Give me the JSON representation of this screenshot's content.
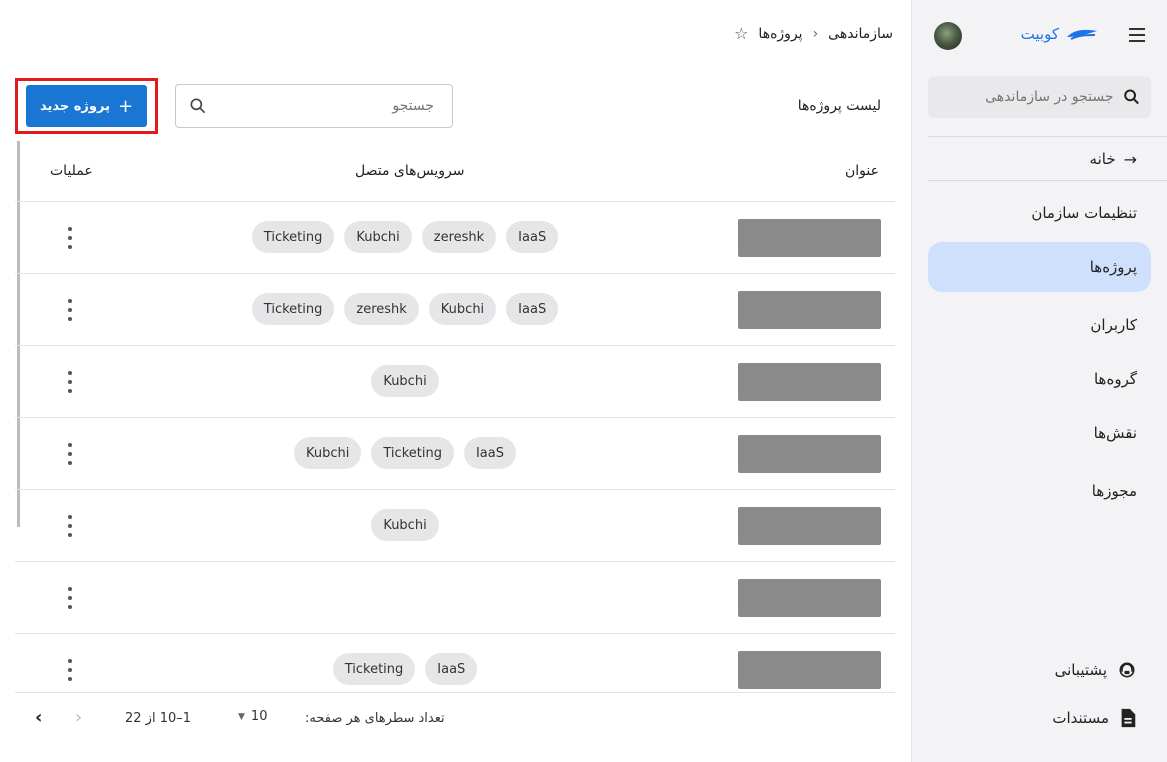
{
  "sidebar": {
    "brand_name": "کوبیت",
    "search_placeholder": "جستجو در سازماندهی",
    "back_label": "خانه",
    "items": [
      {
        "label": "تنظیمات سازمان"
      },
      {
        "label": "پروژه‌ها",
        "active": true
      },
      {
        "label": "کاربران"
      },
      {
        "label": "گروه‌ها"
      },
      {
        "label": "نقش‌ها"
      },
      {
        "label": "مجوزها"
      }
    ],
    "support_label": "پشتیبانی",
    "docs_label": "مستندات"
  },
  "breadcrumb": {
    "parent": "سازماندهی",
    "current": "پروژه‌ها"
  },
  "main": {
    "list_title": "لیست پروژه‌ها",
    "search_placeholder": "جستجو",
    "new_button_label": "پروژه جدید"
  },
  "table": {
    "headers": {
      "title": "عنوان",
      "services": "سرویس‌های متصل",
      "actions": "عملیات"
    },
    "rows": [
      {
        "services": [
          "IaaS",
          "zereshk",
          "Kubchi",
          "Ticketing"
        ]
      },
      {
        "services": [
          "IaaS",
          "Kubchi",
          "zereshk",
          "Ticketing"
        ]
      },
      {
        "services": [
          "Kubchi"
        ]
      },
      {
        "services": [
          "IaaS",
          "Ticketing",
          "Kubchi"
        ]
      },
      {
        "services": [
          "Kubchi"
        ]
      },
      {
        "services": []
      },
      {
        "services": [
          "IaaS",
          "Ticketing"
        ]
      }
    ]
  },
  "pagination": {
    "rows_per_page_label": "تعداد سطرهای هر صفحه:",
    "rows_per_page_value": "10",
    "range_label": "1–10 از 22"
  },
  "colors": {
    "accent": "#1976d2",
    "active_nav": "#cfe0fd",
    "highlight_border": "#e11b1b"
  }
}
